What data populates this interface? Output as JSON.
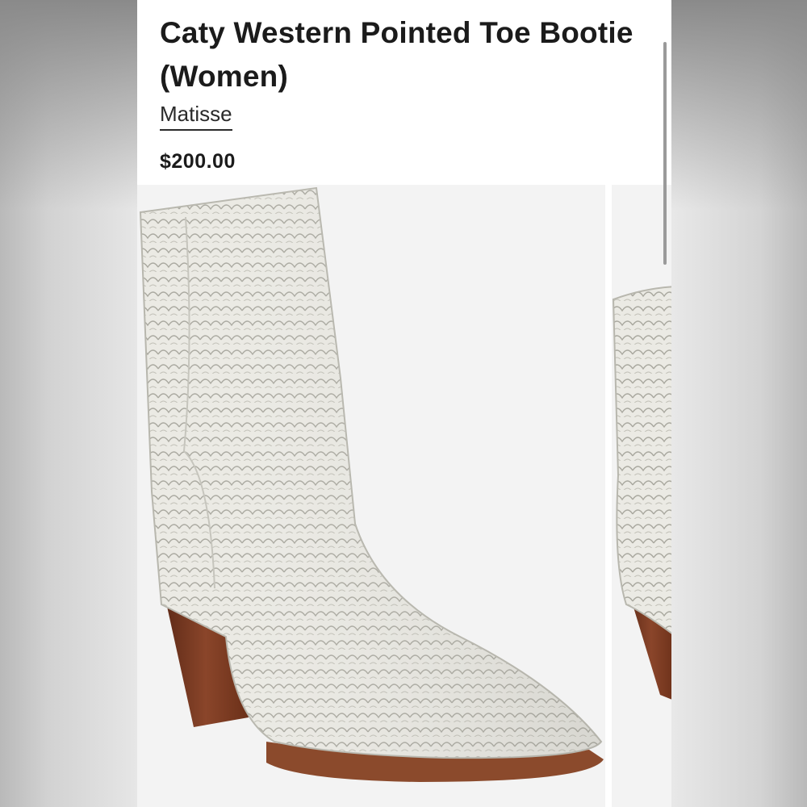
{
  "product": {
    "title": "Caty Western Pointed Toe Bootie (Women)",
    "brand": "Matisse",
    "price": "$200.00"
  },
  "gallery": {
    "images": [
      {
        "description_icon": "white-snakeskin-boot-image"
      },
      {
        "description_icon": "white-snakeskin-boot-partial-image"
      }
    ]
  },
  "colors": {
    "boot_body": "#e9e8e2",
    "heel": "#7a3a22",
    "background": "#f3f3f3"
  }
}
